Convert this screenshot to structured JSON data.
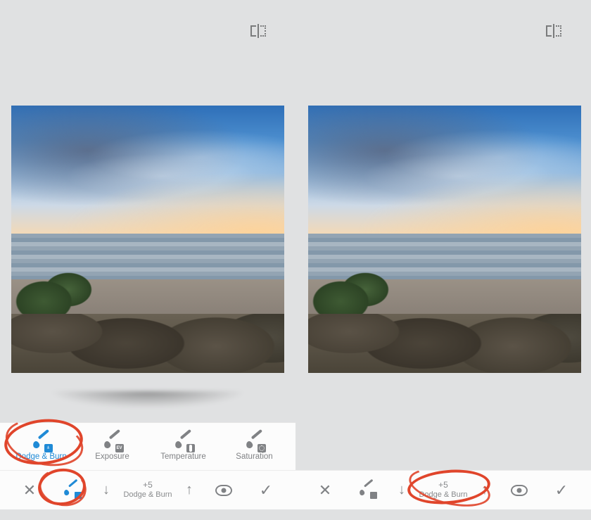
{
  "header": {
    "compare_tooltip": "Compare"
  },
  "tools": {
    "items": [
      {
        "key": "dodge_burn",
        "label": "Dodge & Burn",
        "active": true,
        "badge": "±"
      },
      {
        "key": "exposure",
        "label": "Exposure",
        "active": false,
        "badge": "EV"
      },
      {
        "key": "temperature",
        "label": "Temperature",
        "active": false,
        "badge": "therm"
      },
      {
        "key": "saturation",
        "label": "Saturation",
        "active": false,
        "badge": "ring"
      }
    ]
  },
  "actions": {
    "cancel_label": "Cancel",
    "brush_label": "Brush mode",
    "decrease_label": "Decrease",
    "increase_label": "Increase",
    "preview_label": "Preview",
    "apply_label": "Apply",
    "stepper": {
      "value_text": "+5",
      "name_text": "Dodge & Burn"
    }
  },
  "annotations": {
    "left_tool_circle": "highlight: Dodge & Burn tool",
    "left_brush_circle": "highlight: brush mode button",
    "right_value_circle": "highlight: +5 Dodge & Burn value"
  },
  "colors": {
    "accent": "#1f8ad6",
    "annotation": "#e0452b",
    "muted": "#808285"
  }
}
